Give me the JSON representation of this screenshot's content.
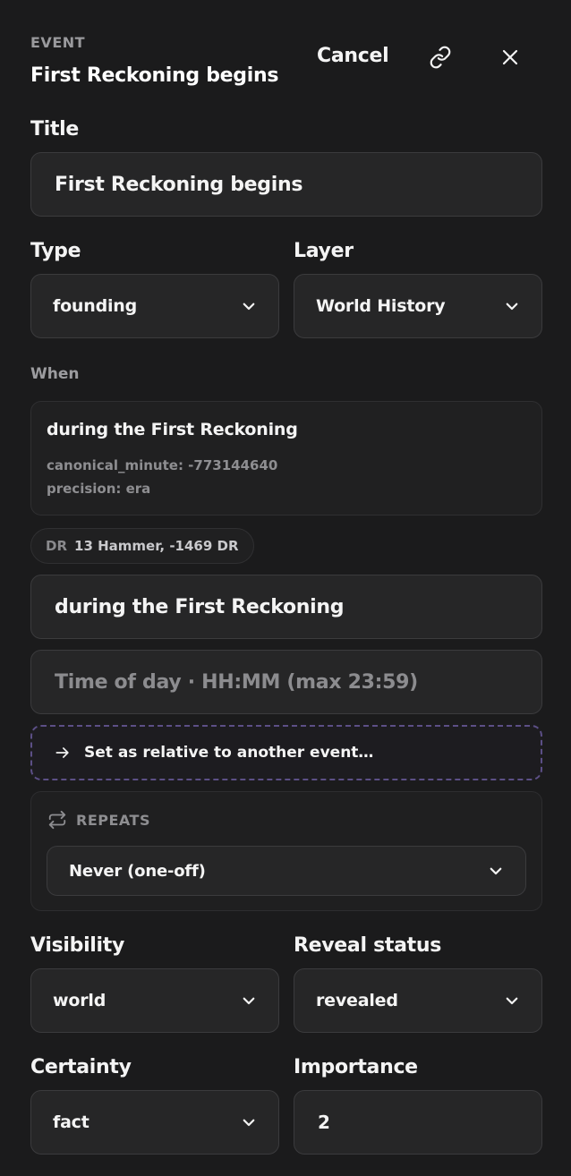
{
  "header": {
    "eyebrow": "EVENT",
    "title": "First Reckoning begins",
    "cancel_label": "Cancel",
    "link_icon": "link-icon",
    "close_icon": "close-icon"
  },
  "form": {
    "title_label": "Title",
    "title_value": "First Reckoning begins",
    "type_label": "Type",
    "type_value": "founding",
    "layer_label": "Layer",
    "layer_value": "World History",
    "when_label": "When",
    "when": {
      "description": "during the First Reckoning",
      "canonical_minute": "canonical_minute: -773144640",
      "precision": "precision: era"
    },
    "calendar_chip": {
      "tag": "DR",
      "value": "13 Hammer, -1469 DR"
    },
    "when_text_value": "during the First Reckoning",
    "time_of_day_placeholder": "Time of day · HH:MM (max 23:59)",
    "relative_label": "Set as relative to another event…",
    "repeats": {
      "heading": "REPEATS",
      "value": "Never (one-off)"
    },
    "visibility_label": "Visibility",
    "visibility_value": "world",
    "reveal_label": "Reveal status",
    "reveal_value": "revealed",
    "certainty_label": "Certainty",
    "certainty_value": "fact",
    "importance_label": "Importance",
    "importance_value": "2"
  },
  "colors": {
    "background": "#1b1b1c",
    "field": "#262627",
    "dashed_border": "#5c4f86"
  }
}
